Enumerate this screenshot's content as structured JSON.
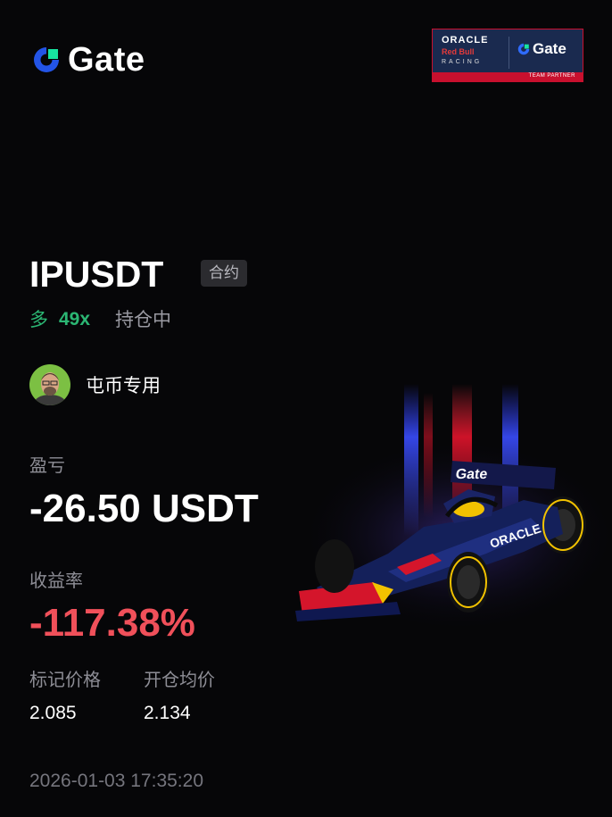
{
  "brand": {
    "name": "Gate",
    "logo_icon": "gate-logo-icon"
  },
  "partner_badge": {
    "oracle": "ORACLE",
    "redbull": "Red Bull",
    "racing": "RACING",
    "gate": "Gate",
    "partner_label": "TEAM PARTNER"
  },
  "position": {
    "symbol": "IPUSDT",
    "type_tag": "合约",
    "direction": "多",
    "leverage": "49x",
    "status": "持仓中"
  },
  "user": {
    "name": "屯币专用",
    "avatar_icon": "user-avatar"
  },
  "pnl": {
    "label": "盈亏",
    "value": "-26.50 USDT"
  },
  "roi": {
    "label": "收益率",
    "value": "-117.38%"
  },
  "prices": {
    "mark_label": "标记价格",
    "mark_value": "2.085",
    "entry_label": "开仓均价",
    "entry_value": "2.134"
  },
  "timestamp": "2026-01-03 17:35:20",
  "colors": {
    "background": "#060608",
    "long_green": "#2bb673",
    "loss_red": "#f0505a",
    "gate_blue": "#2354e6",
    "gate_green": "#17e5a1"
  }
}
